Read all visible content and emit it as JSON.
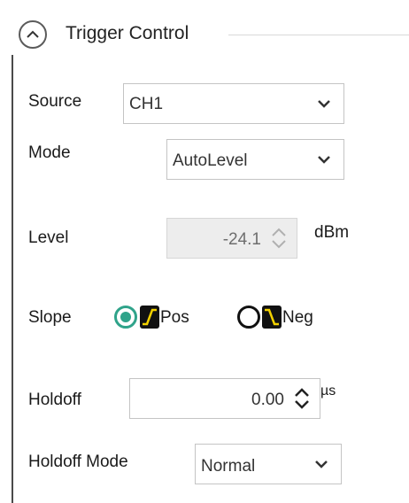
{
  "header": {
    "title": "Trigger Control",
    "collapse_icon": "chevron-up-icon"
  },
  "source": {
    "label": "Source",
    "value": "CH1"
  },
  "mode": {
    "label": "Mode",
    "value": "AutoLevel"
  },
  "level": {
    "label": "Level",
    "value": "-24.1",
    "unit": "dBm",
    "enabled": false
  },
  "slope": {
    "label": "Slope",
    "selected": "Pos",
    "options": [
      {
        "label": "Pos",
        "icon": "rising-edge-icon"
      },
      {
        "label": "Neg",
        "icon": "falling-edge-icon"
      }
    ]
  },
  "holdoff": {
    "label": "Holdoff",
    "value": "0.00",
    "unit": "µs"
  },
  "holdoff_mode": {
    "label": "Holdoff Mode",
    "value": "Normal"
  },
  "colors": {
    "accent": "#2fa38a",
    "border": "#c4c4c4",
    "disabled_bg": "#ededed",
    "icon_fill": "#111111"
  }
}
